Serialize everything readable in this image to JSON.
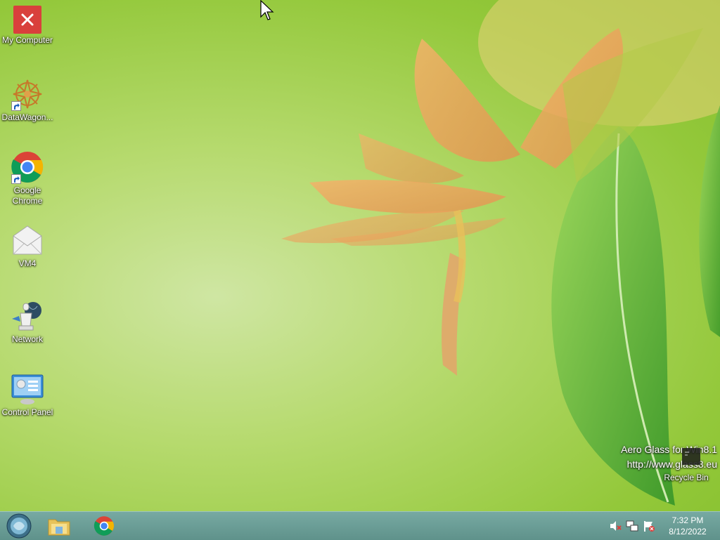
{
  "desktop": {
    "icons": [
      {
        "label": "My Computer",
        "icon": "error-x-icon"
      },
      {
        "label": "DataWagon...",
        "icon": "datawagon-icon"
      },
      {
        "label": "Google Chrome",
        "icon": "chrome-icon"
      },
      {
        "label": "VM4",
        "icon": "mail-envelope-icon"
      },
      {
        "label": "Network",
        "icon": "network-icon"
      },
      {
        "label": "Control Panel",
        "icon": "control-panel-icon"
      }
    ],
    "recycle_bin": {
      "label": "Recycle Bin"
    }
  },
  "watermark": {
    "line1": "Aero Glass for Win8.1",
    "line2": "http://www.glass8.eu"
  },
  "taskbar": {
    "start_icon": "start-orb-icon",
    "pinned": [
      "file-explorer-icon",
      "chrome-icon"
    ],
    "tray_icons": [
      "volume-muted-icon",
      "network-tray-icon",
      "action-center-flag-icon"
    ],
    "clock": {
      "time": "7:32 PM",
      "date": "8/12/2022"
    }
  },
  "colors": {
    "taskbar": "#6a9e97",
    "error_red": "#d9403c"
  }
}
